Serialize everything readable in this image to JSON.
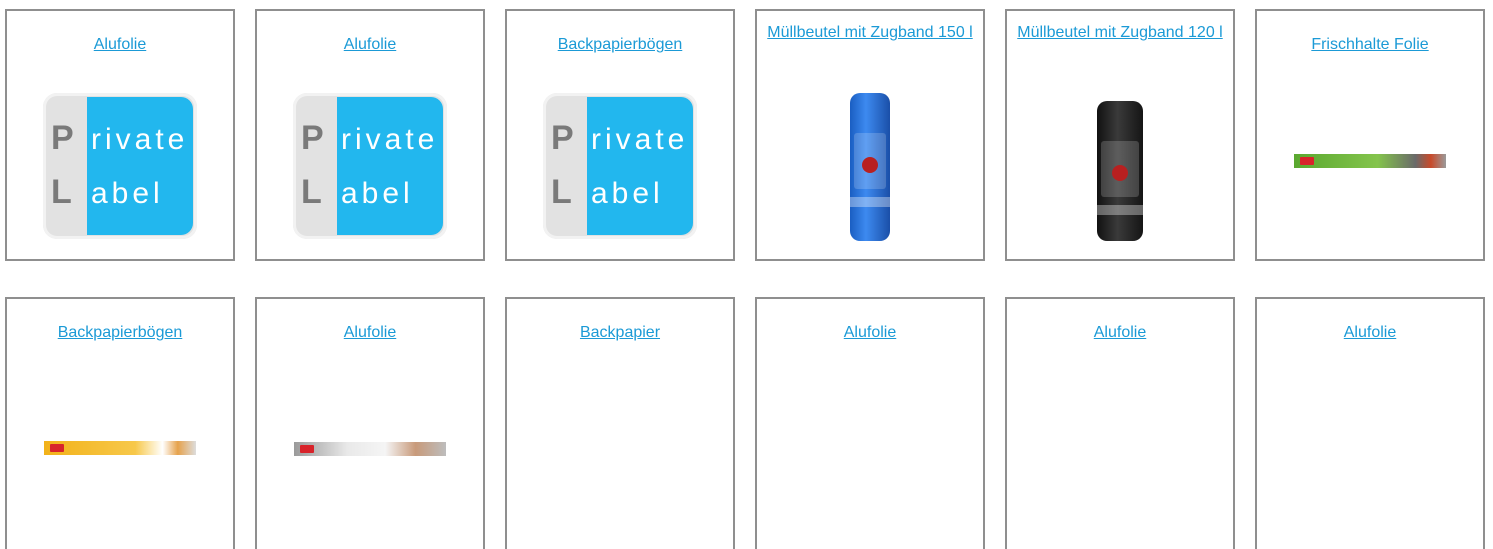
{
  "products": [
    {
      "name": "Alufolie",
      "image": "private-label-logo"
    },
    {
      "name": "Alufolie ",
      "image": "private-label-logo"
    },
    {
      "name": "Backpapierbögen",
      "image": "private-label-logo"
    },
    {
      "name": "Müllbeutel mit Zugband 150 l",
      "image": "blue-bag-roll"
    },
    {
      "name": "Müllbeutel mit Zugband 120 l",
      "image": "black-bag-roll"
    },
    {
      "name": "Frischhalte Folie",
      "image": "green-film-box"
    },
    {
      "name": "Backpapierbögen",
      "image": "yellow-paper-box"
    },
    {
      "name": "Alufolie",
      "image": "silver-foil-box"
    },
    {
      "name": "Backpapier",
      "image": "none"
    },
    {
      "name": "Alufolie",
      "image": "none"
    },
    {
      "name": "Alufolie",
      "image": "none"
    },
    {
      "name": "Alufolie ",
      "image": "none"
    }
  ],
  "logo": {
    "big1": "P",
    "rest1": "rivate",
    "big2": "L",
    "rest2": "abel"
  },
  "colors": {
    "link": "#1b9ad6",
    "border": "#8f8f8f",
    "logo_blue": "#22b7ee"
  }
}
